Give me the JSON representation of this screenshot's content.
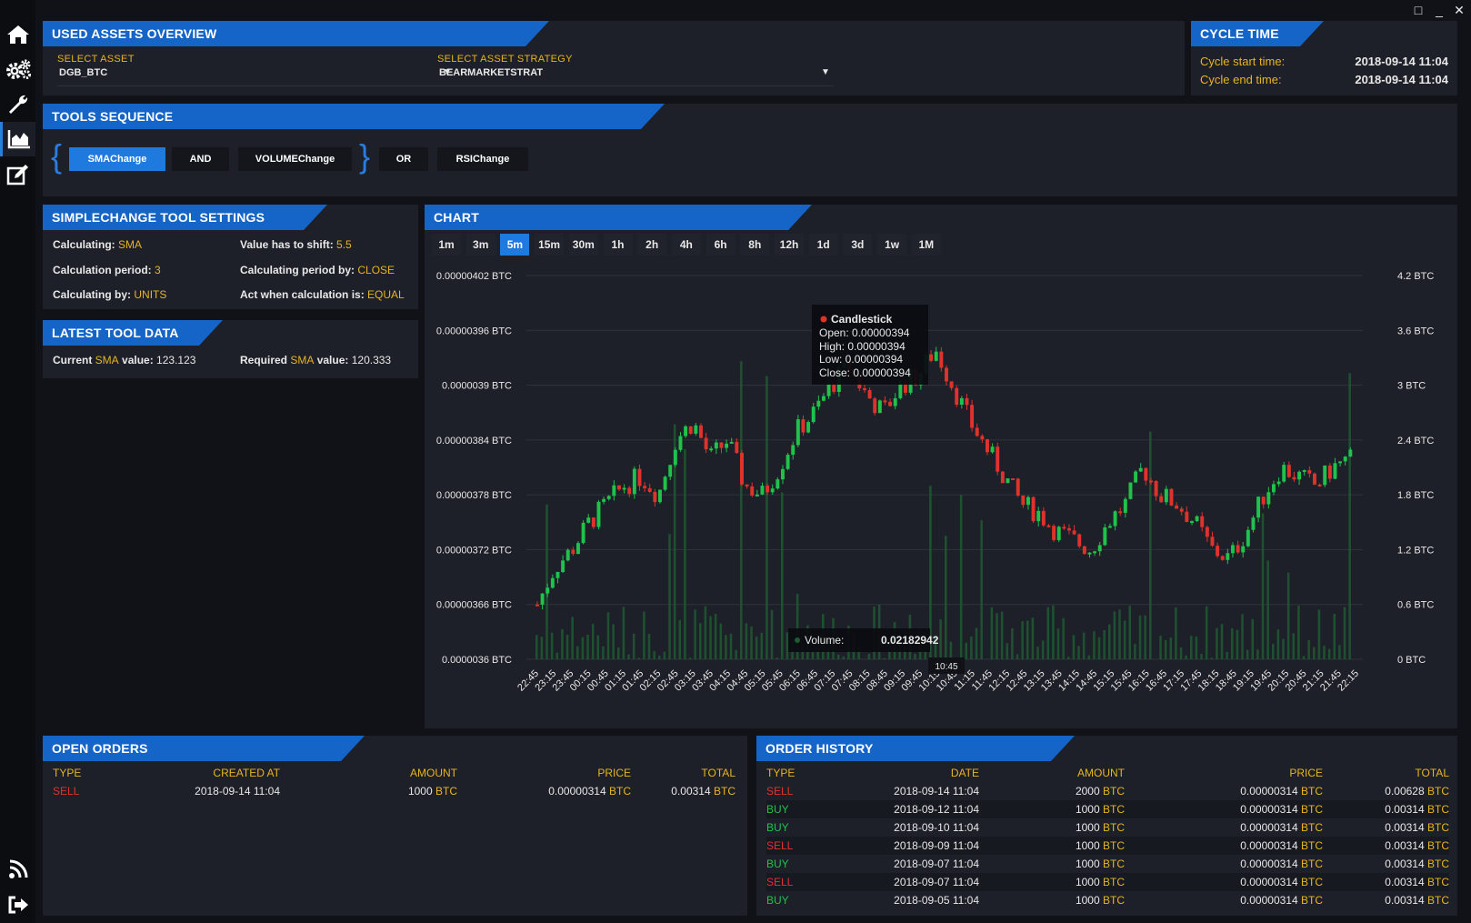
{
  "window": {
    "controls": [
      "□",
      "_",
      "✕"
    ]
  },
  "sidebar": {
    "items": [
      {
        "icon": "home-icon"
      },
      {
        "icon": "gears-icon"
      },
      {
        "icon": "wrench-icon"
      },
      {
        "icon": "area-chart-icon",
        "active": true
      },
      {
        "icon": "edit-icon"
      },
      {
        "icon": "rss-icon"
      },
      {
        "icon": "logout-icon"
      }
    ]
  },
  "assets": {
    "title": "USED ASSETS OVERVIEW",
    "asset_label": "SELECT ASSET",
    "asset_value": "DGB_BTC",
    "strategy_label": "SELECT ASSET STRATEGY",
    "strategy_value": "BEARMARKETSTRAT",
    "arrow": "▼"
  },
  "cycle": {
    "title": "CYCLE TIME",
    "start_label": "Cycle start time:",
    "start_value": "2018-09-14 11:04",
    "end_label": "Cycle end time:",
    "end_value": "2018-09-14 11:04"
  },
  "tools": {
    "title": "TOOLS SEQUENCE",
    "open_brace": "{",
    "close_brace": "}",
    "items": [
      "SMAChange",
      "AND",
      "VOLUMEChange",
      "OR",
      "RSIChange"
    ]
  },
  "settings": {
    "title": "SIMPLECHANGE TOOL SETTINGS",
    "calculating_label": "Calculating:",
    "calculating_value": "SMA",
    "shift_label": "Value has to shift:",
    "shift_value": "5.5",
    "period_label": "Calculation period:",
    "period_value": "3",
    "period_by_label": "Calculating period by:",
    "period_by_value": "CLOSE",
    "by_label": "Calculating by:",
    "by_value": "UNITS",
    "act_label": "Act when calculation is:",
    "act_value": "EQUAL"
  },
  "latest": {
    "title": "LATEST TOOL DATA",
    "current_pre": "Current ",
    "current_mid": "SMA",
    "current_post": " value:",
    "current_value": "123.123",
    "required_pre": "Required ",
    "required_mid": "SMA",
    "required_post": " value:",
    "required_value": "120.333"
  },
  "chart": {
    "title": "CHART",
    "timeframes": [
      "1m",
      "3m",
      "5m",
      "15m",
      "30m",
      "1h",
      "2h",
      "4h",
      "6h",
      "8h",
      "12h",
      "1d",
      "3d",
      "1w",
      "1M"
    ],
    "active_timeframe": "5m",
    "tooltip": {
      "title": "Candlestick",
      "open": "Open: 0.00000394",
      "high": "High: 0.00000394",
      "low": "Low: 0.00000394",
      "close": "Close: 0.00000394"
    },
    "volume_tooltip": {
      "label": "Volume:",
      "value": "0.02182942"
    },
    "crosshair_label": "10:45"
  },
  "chart_data": {
    "type": "candlestick",
    "y_left_ticks": [
      "0.00000402 BTC",
      "0.00000396 BTC",
      "0.0000039 BTC",
      "0.00000384 BTC",
      "0.00000378 BTC",
      "0.00000372 BTC",
      "0.00000366 BTC",
      "0.0000036 BTC"
    ],
    "y_right_ticks": [
      "4.2 BTC",
      "3.6 BTC",
      "3 BTC",
      "2.4 BTC",
      "1.8 BTC",
      "1.2 BTC",
      "0.6 BTC",
      "0 BTC"
    ],
    "x_ticks": [
      "22:45",
      "23:15",
      "23:45",
      "00:15",
      "00:45",
      "01:15",
      "01:45",
      "02:15",
      "02:45",
      "03:15",
      "03:45",
      "04:15",
      "04:45",
      "05:15",
      "05:45",
      "06:15",
      "06:45",
      "07:15",
      "07:45",
      "08:15",
      "08:45",
      "09:15",
      "09:45",
      "10:15",
      "10:45",
      "11:15",
      "11:45",
      "12:15",
      "12:45",
      "13:15",
      "13:45",
      "14:15",
      "14:45",
      "15:15",
      "15:45",
      "16:15",
      "16:45",
      "17:15",
      "17:45",
      "18:15",
      "18:45",
      "19:15",
      "19:45",
      "20:15",
      "20:45",
      "21:15",
      "21:45",
      "22:15"
    ],
    "ylim": [
      3.6e-06,
      4.02e-06
    ],
    "volume_ylim": [
      0,
      4.2
    ],
    "close_path": [
      3.66e-06,
      3.7e-06,
      3.72e-06,
      3.75e-06,
      3.77e-06,
      3.79e-06,
      3.8e-06,
      3.78e-06,
      3.84e-06,
      3.86e-06,
      3.82e-06,
      3.84e-06,
      3.79e-06,
      3.78e-06,
      3.81e-06,
      3.85e-06,
      3.87e-06,
      3.9e-06,
      3.92e-06,
      3.89e-06,
      3.87e-06,
      3.9e-06,
      3.91e-06,
      3.94e-06,
      3.9e-06,
      3.86e-06,
      3.83e-06,
      3.8e-06,
      3.77e-06,
      3.76e-06,
      3.74e-06,
      3.73e-06,
      3.72e-06,
      3.75e-06,
      3.77e-06,
      3.81e-06,
      3.78e-06,
      3.77e-06,
      3.75e-06,
      3.72e-06,
      3.71e-06,
      3.74e-06,
      3.78e-06,
      3.81e-06,
      3.8e-06,
      3.79e-06,
      3.81e-06,
      3.82e-06
    ],
    "grid": true
  },
  "open_orders": {
    "title": "OPEN ORDERS",
    "headers": [
      "TYPE",
      "CREATED AT",
      "AMOUNT",
      "PRICE",
      "TOTAL"
    ],
    "rows": [
      {
        "type": "SELL",
        "date": "2018-09-14 11:04",
        "amount": "1000",
        "price": "0.00000314",
        "total": "0.00314",
        "currency": "BTC"
      }
    ]
  },
  "order_history": {
    "title": "ORDER HISTORY",
    "headers": [
      "TYPE",
      "DATE",
      "AMOUNT",
      "PRICE",
      "TOTAL"
    ],
    "rows": [
      {
        "type": "SELL",
        "date": "2018-09-14 11:04",
        "amount": "2000",
        "price": "0.00000314",
        "total": "0.00628",
        "currency": "BTC"
      },
      {
        "type": "BUY",
        "date": "2018-09-12 11:04",
        "amount": "1000",
        "price": "0.00000314",
        "total": "0.00314",
        "currency": "BTC"
      },
      {
        "type": "BUY",
        "date": "2018-09-10 11:04",
        "amount": "1000",
        "price": "0.00000314",
        "total": "0.00314",
        "currency": "BTC"
      },
      {
        "type": "SELL",
        "date": "2018-09-09 11:04",
        "amount": "1000",
        "price": "0.00000314",
        "total": "0.00314",
        "currency": "BTC"
      },
      {
        "type": "BUY",
        "date": "2018-09-07 11:04",
        "amount": "1000",
        "price": "0.00000314",
        "total": "0.00314",
        "currency": "BTC"
      },
      {
        "type": "SELL",
        "date": "2018-09-07 11:04",
        "amount": "1000",
        "price": "0.00000314",
        "total": "0.00314",
        "currency": "BTC"
      },
      {
        "type": "BUY",
        "date": "2018-09-05 11:04",
        "amount": "1000",
        "price": "0.00000314",
        "total": "0.00314",
        "currency": "BTC"
      }
    ]
  },
  "colors": {
    "accent": "#1f7ae0",
    "gold": "#e6b422",
    "up": "#1fc24a",
    "down": "#e0322c",
    "panel": "#1d2028",
    "bg": "#101217"
  }
}
